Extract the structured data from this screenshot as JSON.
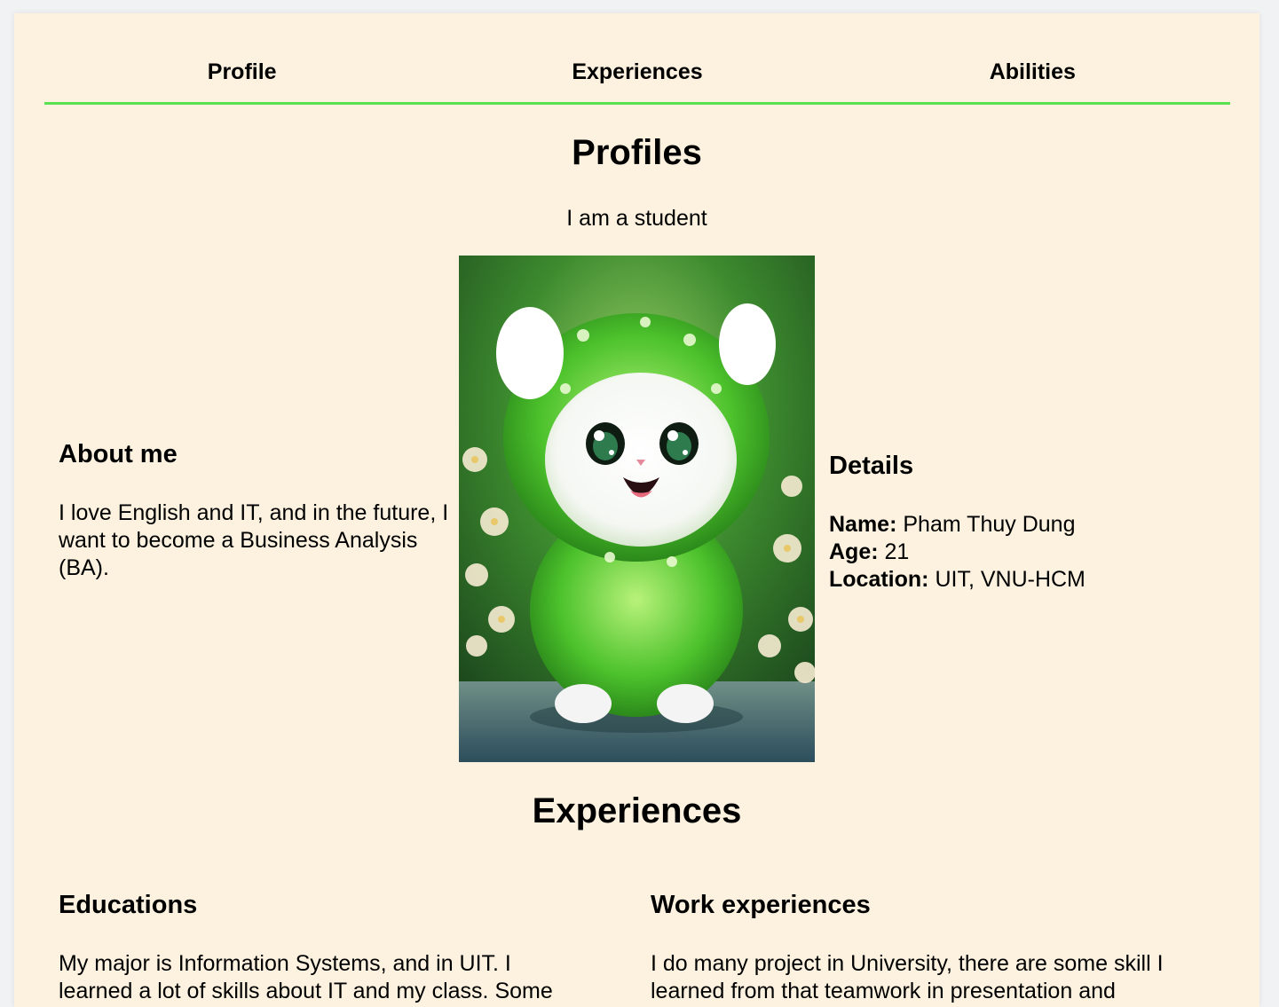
{
  "nav": {
    "items": [
      {
        "label": "Profile"
      },
      {
        "label": "Experiences"
      },
      {
        "label": "Abilities"
      }
    ],
    "accent_color": "#5be14f"
  },
  "profile": {
    "title": "Profiles",
    "subtitle": "I am a student",
    "photo_alt": "fluffy green kitten",
    "about": {
      "heading": "About me",
      "text": "I love English and IT, and in the future, I want to become a Business Analysis (BA)."
    },
    "details": {
      "heading": "Details",
      "name_label": "Name:",
      "name_value": "Pham Thuy Dung",
      "age_label": "Age:",
      "age_value": "21",
      "location_label": "Location:",
      "location_value": "UIT, VNU-HCM"
    }
  },
  "experiences": {
    "title": "Experiences",
    "educations": {
      "heading": "Educations",
      "text": "My major is Information Systems, and in UIT. I learned a lot of skills about IT and my class. Some"
    },
    "work": {
      "heading": "Work experiences",
      "text": "I do many project in University, there are some skill I learned from that teamwork in presentation and"
    }
  },
  "colors": {
    "page_background": "#fdf2df",
    "outer_background": "#f1f2f3"
  }
}
